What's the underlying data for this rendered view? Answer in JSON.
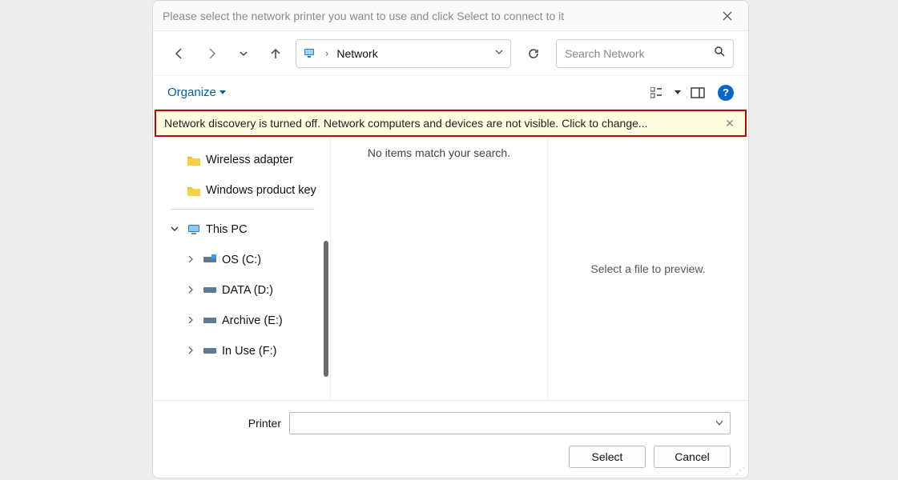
{
  "title": "Please select the network printer you want to use and click Select to connect to it",
  "address": {
    "location": "Network"
  },
  "search": {
    "placeholder": "Search Network"
  },
  "toolbar": {
    "organize": "Organize"
  },
  "notification": "Network discovery is turned off. Network computers and devices are not visible. Click to change...",
  "tree": {
    "folders": [
      {
        "label": "Wireless adapter"
      },
      {
        "label": "Windows product key"
      }
    ],
    "root": "This PC",
    "drives": [
      {
        "label": "OS (C:)"
      },
      {
        "label": "DATA (D:)"
      },
      {
        "label": "Archive (E:)"
      },
      {
        "label": "In Use (F:)"
      }
    ]
  },
  "content": {
    "empty": "No items match your search."
  },
  "preview": {
    "empty": "Select a file to preview."
  },
  "bottom": {
    "label": "Printer",
    "select": "Select",
    "cancel": "Cancel"
  }
}
